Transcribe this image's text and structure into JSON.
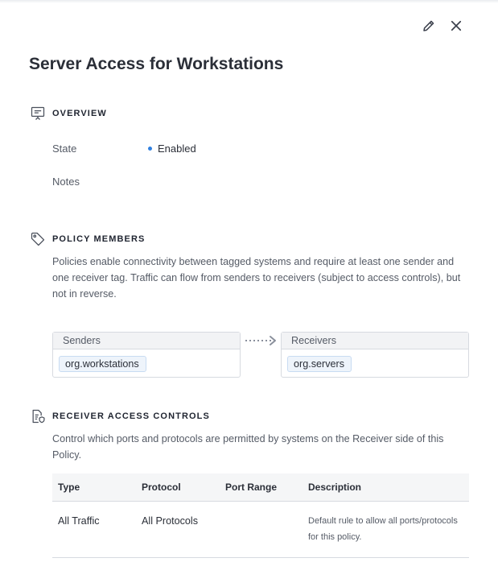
{
  "header": {
    "title": "Server Access for Workstations",
    "edit_icon": "pencil-icon",
    "close_icon": "close-icon"
  },
  "overview": {
    "heading": "OVERVIEW",
    "icon": "presentation-board-icon",
    "state_label": "State",
    "state_value": "Enabled",
    "state_color": "#2f7fe0",
    "notes_label": "Notes",
    "notes_value": ""
  },
  "policy_members": {
    "heading": "POLICY MEMBERS",
    "icon": "tag-icon",
    "description": "Policies enable connectivity between tagged systems and require at least one sender and one receiver tag. Traffic can flow from senders to receivers (subject to access controls), but not in reverse.",
    "senders_label": "Senders",
    "senders": [
      "org.workstations"
    ],
    "receivers_label": "Receivers",
    "receivers": [
      "org.servers"
    ]
  },
  "receiver_access": {
    "heading": "RECEIVER ACCESS CONTROLS",
    "icon": "document-shield-icon",
    "description": "Control which ports and protocols are permitted by systems on the Receiver side of this Policy.",
    "columns": [
      "Type",
      "Protocol",
      "Port Range",
      "Description"
    ],
    "rows": [
      [
        "All Traffic",
        "All Protocols",
        "",
        "Default rule to allow all ports/protocols for this policy."
      ]
    ]
  }
}
